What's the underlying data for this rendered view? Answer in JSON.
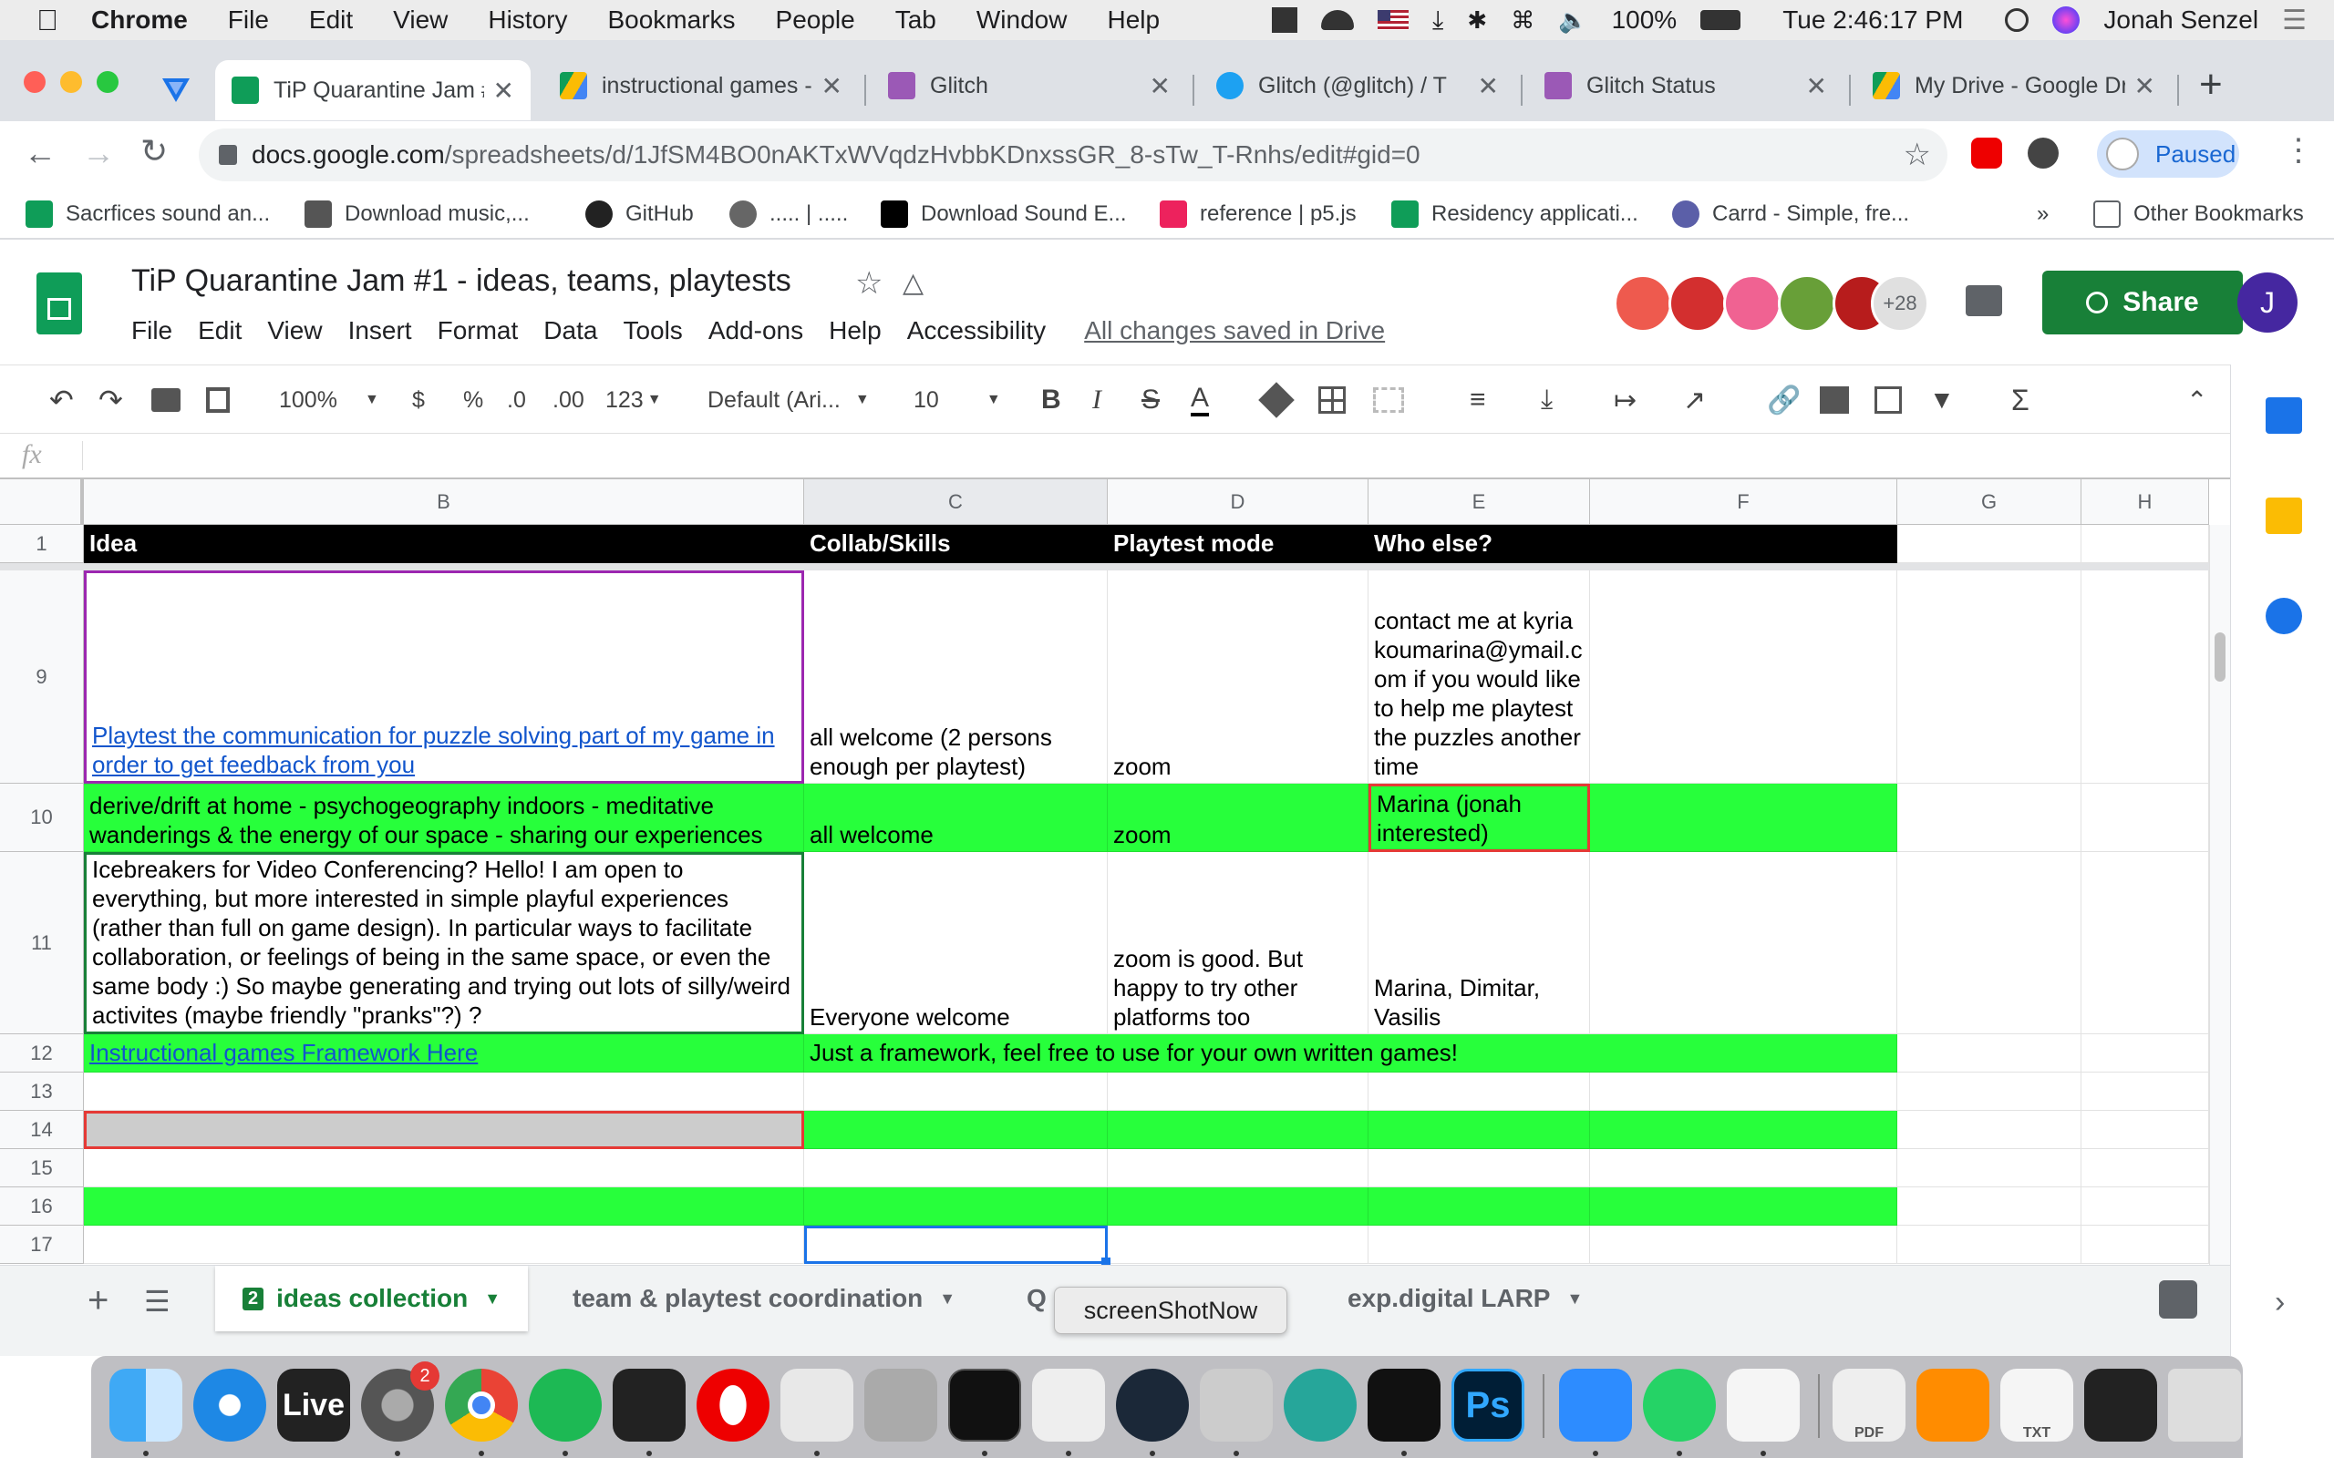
{
  "menubar": {
    "app": "Chrome",
    "items": [
      "File",
      "Edit",
      "View",
      "History",
      "Bookmarks",
      "People",
      "Tab",
      "Window",
      "Help"
    ],
    "battery": "100%",
    "clock": "Tue 2:46:17 PM",
    "user": "Jonah Senzel"
  },
  "tabs": [
    {
      "label": "TiP Quarantine Jam #",
      "color": "#0f9d58"
    },
    {
      "label": "instructional games -",
      "color": "#fbbc04"
    },
    {
      "label": "Glitch",
      "color": "#9b59b6"
    },
    {
      "label": "Glitch (@glitch) / T",
      "color": "#1da1f2"
    },
    {
      "label": "Glitch Status",
      "color": "#9b59b6"
    },
    {
      "label": "My Drive - Google Dr",
      "color": "#fbbc04"
    }
  ],
  "url": {
    "host": "docs.google.com",
    "path": "/spreadsheets/d/1JfSM4BO0nAKTxWVqdzHvbbKDnxssGR_8-sTw_T-Rnhs/edit#gid=0"
  },
  "profile_status": "Paused",
  "bookmarks": [
    "Sacrfices sound an...",
    "Download music,...",
    "GitHub",
    "..... | .....",
    "Download Sound E...",
    "reference | p5.js",
    "Residency applicati...",
    "Carrd - Simple, fre...",
    "»",
    "Other Bookmarks"
  ],
  "doc": {
    "title": "TiP Quarantine Jam #1 - ideas, teams, playtests",
    "menus": [
      "File",
      "Edit",
      "View",
      "Insert",
      "Format",
      "Data",
      "Tools",
      "Add-ons",
      "Help",
      "Accessibility"
    ],
    "save_status": "All changes saved in Drive",
    "collab_more": "+28",
    "share_label": "Share",
    "user_initial": "J"
  },
  "toolbar": {
    "zoom": "100%",
    "currency": "$",
    "percent": "%",
    "dec_less": ".0",
    "dec_more": ".00",
    "more_formats": "123",
    "font": "Default (Ari...",
    "size": "10"
  },
  "fx": "fx",
  "columns": [
    "B",
    "C",
    "D",
    "E",
    "F",
    "G",
    "H"
  ],
  "rows": [
    "1",
    "9",
    "10",
    "11",
    "12",
    "13",
    "14",
    "15",
    "16",
    "17"
  ],
  "cells": {
    "r1": {
      "b": "Idea",
      "c": "Collab/Skills",
      "d": "Playtest mode",
      "e": "Who else?"
    },
    "r9": {
      "b": "Playtest the communication for puzzle solving part of my game in order to get feedback from you",
      "c": "all welcome (2 persons enough per playtest)",
      "d": "zoom",
      "e": "contact me at kyriakoumarina@ymail.com if you would like to help me playtest the puzzles another time"
    },
    "r10": {
      "b": "derive/drift at home - psychogeography indoors - meditative wanderings & the energy of our space - sharing our experiences",
      "c": "all welcome",
      "d": "zoom",
      "e": "Marina (jonah interested)"
    },
    "r11": {
      "b": "Icebreakers for Video Conferencing?   Hello! I am open to everything, but more interested in simple playful experiences (rather than full on game design). In particular ways to facilitate collaboration, or feelings of being in the same space,  or even the same body :)   So maybe generating and trying out lots of silly/weird activites (maybe friendly \"pranks\"?)  ?",
      "c": "Everyone welcome",
      "d": "zoom is good.  But happy to try other platforms too",
      "e": "Marina, Dimitar, Vasilis"
    },
    "r12": {
      "b": "Instructional games Framework Here",
      "c": "Just a framework, feel free to use for your own written games!"
    }
  },
  "sheets": {
    "badge": "2",
    "tabs": [
      "ideas collection",
      "team & playtest coordination",
      "Q",
      "exp.digital LARP"
    ]
  },
  "tooltip": "screenShotNow",
  "dock": [
    "Finder",
    "Safari",
    "Live",
    "System Preferences",
    "Chrome",
    "Spotify",
    "Terminal",
    "Opera",
    "Script Editor",
    "Rocket",
    "Activity Monitor",
    "Unity",
    "Steam",
    "Automator",
    "Sketch",
    "Typora",
    "Ps",
    "Zoom",
    "WhatsApp",
    "TextEdit",
    "Preview",
    "VLC",
    "TXT",
    "Screenshot",
    "Trash"
  ],
  "dock_badge": "2",
  "dock_labels": {
    "live": "Live",
    "ps": "Ps",
    "pdf": "PDF",
    "txt": "TXT"
  }
}
